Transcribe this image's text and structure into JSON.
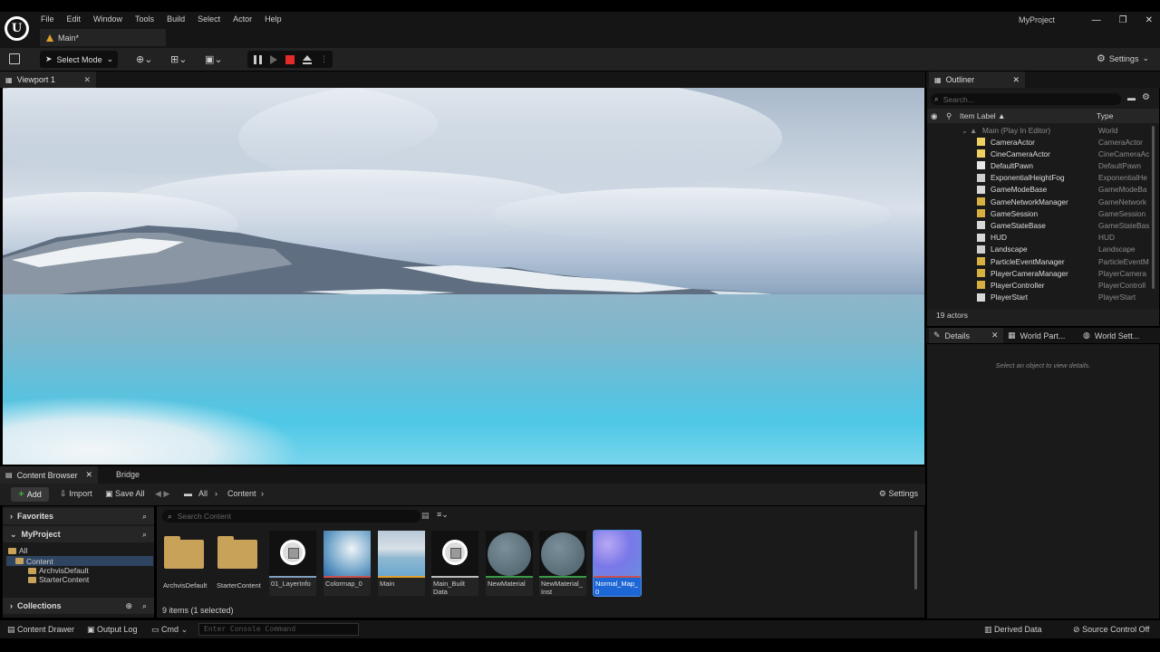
{
  "menu": [
    "File",
    "Edit",
    "Window",
    "Tools",
    "Build",
    "Select",
    "Actor",
    "Help"
  ],
  "document_tab": "Main*",
  "project_name": "MyProject",
  "window_buttons": [
    "—",
    "❐",
    "✕"
  ],
  "toolbar": {
    "select_mode": "Select Mode",
    "settings": "Settings"
  },
  "viewport_tab": "Viewport 1",
  "content_browser": {
    "tab": "Content Browser",
    "tab2": "Bridge",
    "add": "Add",
    "import": "Import",
    "save_all": "Save All",
    "path": [
      "All",
      "Content"
    ],
    "settings": "Settings",
    "favorites": "Favorites",
    "project": "MyProject",
    "tree": [
      "All",
      "Content",
      "ArchvisDefault",
      "StarterContent"
    ],
    "collections": "Collections",
    "search_placeholder": "Search Content",
    "assets": [
      {
        "label": "ArchvisDefault",
        "kind": "folder"
      },
      {
        "label": "StarterContent",
        "kind": "folder"
      },
      {
        "label": "01_LayerInfo",
        "kind": "cube"
      },
      {
        "label": "Colormap_0",
        "kind": "map"
      },
      {
        "label": "Main",
        "kind": "level"
      },
      {
        "label": "Main_Built\nData",
        "kind": "cube"
      },
      {
        "label": "NewMaterial",
        "kind": "sphere"
      },
      {
        "label": "NewMaterial_\nInst",
        "kind": "sphere"
      },
      {
        "label": "Normal_Map_\n0",
        "kind": "normal"
      }
    ],
    "count": "9 items (1 selected)"
  },
  "outliner": {
    "tab": "Outliner",
    "search_placeholder": "Search...",
    "col_label": "Item Label ▲",
    "col_type": "Type",
    "world": {
      "name": "Main (Play In Editor)",
      "type": "World"
    },
    "rows": [
      {
        "name": "CameraActor",
        "type": "CameraActor",
        "color": "#f0d060"
      },
      {
        "name": "CineCameraActor",
        "type": "CineCameraAc",
        "color": "#f0d060"
      },
      {
        "name": "DefaultPawn",
        "type": "DefaultPawn",
        "color": "#e8e8e8"
      },
      {
        "name": "ExponentialHeightFog",
        "type": "ExponentialHe",
        "color": "#cfcfcf"
      },
      {
        "name": "GameModeBase",
        "type": "GameModeBa",
        "color": "#d8d8d8"
      },
      {
        "name": "GameNetworkManager",
        "type": "GameNetwork",
        "color": "#d8b040"
      },
      {
        "name": "GameSession",
        "type": "GameSession",
        "color": "#d8b040"
      },
      {
        "name": "GameStateBase",
        "type": "GameStateBas",
        "color": "#d8d8d8"
      },
      {
        "name": "HUD",
        "type": "HUD",
        "color": "#d8d8d8"
      },
      {
        "name": "Landscape",
        "type": "Landscape",
        "color": "#cfcfcf"
      },
      {
        "name": "ParticleEventManager",
        "type": "ParticleEventM",
        "color": "#d8b040"
      },
      {
        "name": "PlayerCameraManager",
        "type": "PlayerCamera",
        "color": "#d8b040"
      },
      {
        "name": "PlayerController",
        "type": "PlayerControll",
        "color": "#d8b040"
      },
      {
        "name": "PlayerStart",
        "type": "PlayerStart",
        "color": "#d8d8d8"
      }
    ],
    "footer": "19 actors"
  },
  "details": {
    "tabs": [
      "Details",
      "World Part...",
      "World Sett..."
    ],
    "empty": "Select an object to view details."
  },
  "statusbar": {
    "content_drawer": "Content Drawer",
    "output_log": "Output Log",
    "cmd": "Cmd",
    "console_placeholder": "Enter Console Command",
    "derived_data": "Derived Data",
    "source_control": "Source Control Off"
  },
  "colors": {
    "accent_blue": "#1d66d6",
    "stop_red": "#e52a2a",
    "folder": "#c9a25a"
  }
}
